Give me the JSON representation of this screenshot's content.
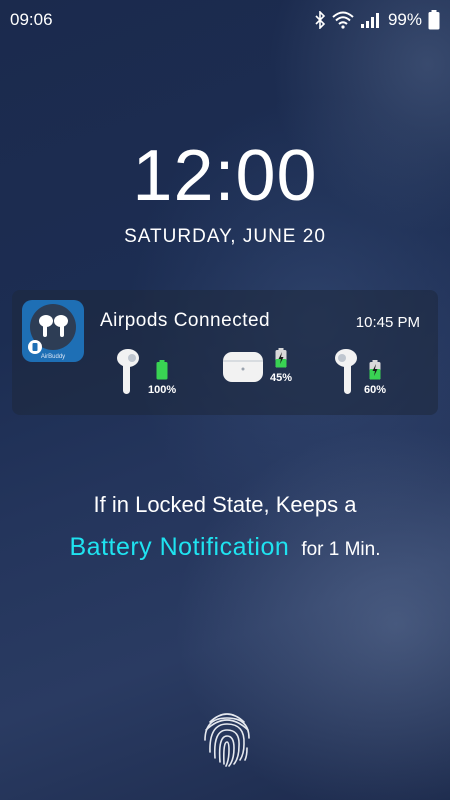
{
  "status_bar": {
    "time": "09:06",
    "battery": "99%",
    "icons": [
      "bluetooth-icon",
      "wifi-icon",
      "signal-icon",
      "battery-icon"
    ]
  },
  "lock_screen": {
    "clock": "12:00",
    "date": "SATURDAY, JUNE 20"
  },
  "notification": {
    "app_icon_label": "AirBuddy",
    "title": "Airpods Connected",
    "time": "10:45 PM",
    "devices": [
      {
        "name": "left-airpod",
        "battery": "100%",
        "level": 1.0
      },
      {
        "name": "case",
        "battery": "45%",
        "level": 0.45
      },
      {
        "name": "right-airpod",
        "battery": "60%",
        "level": 0.6
      }
    ]
  },
  "promo": {
    "line1": "If in Locked State, Keeps a",
    "highlight": "Battery Notification",
    "tail": "for 1 Min."
  },
  "colors": {
    "accent": "#1fe3f0",
    "battery_green": "#39d353"
  }
}
